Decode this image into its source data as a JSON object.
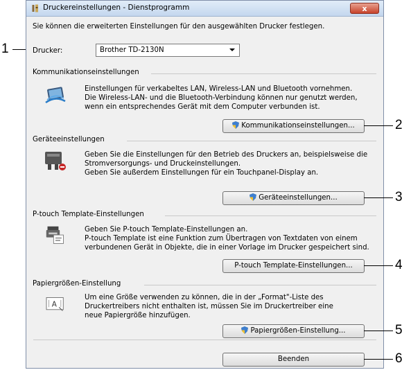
{
  "window": {
    "title": "Druckereinstellungen - Dienstprogramm",
    "close_label": "x"
  },
  "intro_text": "Sie können die erweiterten Einstellungen für den ausgewählten Drucker festlegen.",
  "printer": {
    "label": "Drucker:",
    "selected": "Brother TD-2130N"
  },
  "groups": [
    {
      "title": "Kommunikationseinstellungen",
      "lines": [
        "Einstellungen für verkabeltes LAN, Wireless-LAN und Bluetooth vornehmen.",
        "Die Wireless-LAN- und die Bluetooth-Verbindung können nur genutzt werden,",
        "wenn ein entsprechendes Gerät mit dem Computer verbunden ist."
      ],
      "button": "Kommunikationseinstellungen...",
      "icon": "network-icon"
    },
    {
      "title": "Geräteeinstellungen",
      "lines": [
        "Geben Sie die Einstellungen für den Betrieb des Druckers an, beispielsweise die",
        "Stromversorgungs- und Druckeinstellungen.",
        "Geben Sie außerdem Einstellungen für ein Touchpanel-Display an."
      ],
      "button": "Geräteeinstellungen...",
      "icon": "device-settings-icon"
    },
    {
      "title": "P-touch Template-Einstellungen",
      "lines": [
        "Geben Sie P-touch Template-Einstellungen an.",
        "P-touch Template ist eine Funktion zum Übertragen von Textdaten von einem",
        "verbundenen Gerät in Objekte, die in einer Vorlage im Drucker gespeichert sind."
      ],
      "button": "P-touch Template-Einstellungen...",
      "icon": "template-icon"
    },
    {
      "title": "Papiergrößen-Einstellung",
      "lines": [
        "Um eine Größe verwenden zu können, die in der „Format\"-Liste des",
        "Druckertreibers nicht enthalten ist, müssen Sie im Druckertreiber eine",
        "neue Papiergröße hinzufügen."
      ],
      "button": "Papiergrößen-Einstellung...",
      "icon": "paper-size-icon"
    }
  ],
  "exit_button": "Beenden",
  "callouts": [
    "1",
    "2",
    "3",
    "4",
    "5",
    "6"
  ]
}
